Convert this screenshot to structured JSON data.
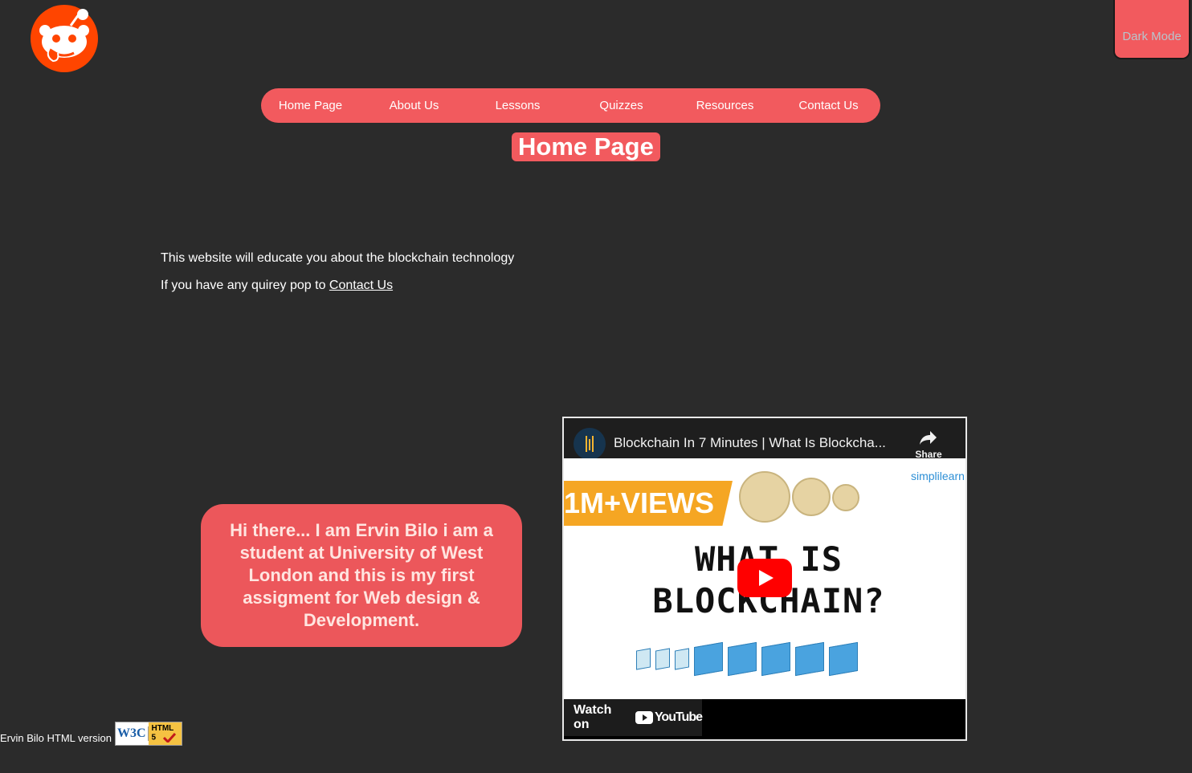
{
  "header": {
    "dark_mode_label": "Dark Mode"
  },
  "nav": {
    "items": [
      {
        "label": "Home Page"
      },
      {
        "label": "About Us"
      },
      {
        "label": "Lessons"
      },
      {
        "label": "Quizzes"
      },
      {
        "label": "Resources"
      },
      {
        "label": "Contact Us"
      }
    ]
  },
  "main": {
    "title": "Home Page",
    "intro_line": "This website will educate you about the blockchain technology",
    "contact_prefix": "If you have any quirey pop to ",
    "contact_link": "Contact Us",
    "bio": "Hi there... I am Ervin Bilo i am a student at University of West London and this is my first assigment for Web design & Development."
  },
  "video": {
    "title": "Blockchain In 7 Minutes | What Is Blockcha...",
    "share_label": "Share",
    "views_banner": "1M+VIEWS",
    "brand": "simplilearn",
    "thumb_line1": "WHAT IS",
    "thumb_line2": "BLOCKCHAIN?",
    "watch_on": "Watch on",
    "youtube": "YouTube"
  },
  "footer": {
    "text": "Ervin Bilo HTML version",
    "badge_w3": "W3C",
    "badge_html": "HTML",
    "badge_num": "5"
  },
  "colors": {
    "accent": "#f25a5e",
    "background": "#2b2b2b",
    "bio_bg": "#ec575b"
  },
  "icons": [
    "reddit-logo-icon",
    "share-icon",
    "play-icon",
    "youtube-icon",
    "html5-check-icon"
  ]
}
